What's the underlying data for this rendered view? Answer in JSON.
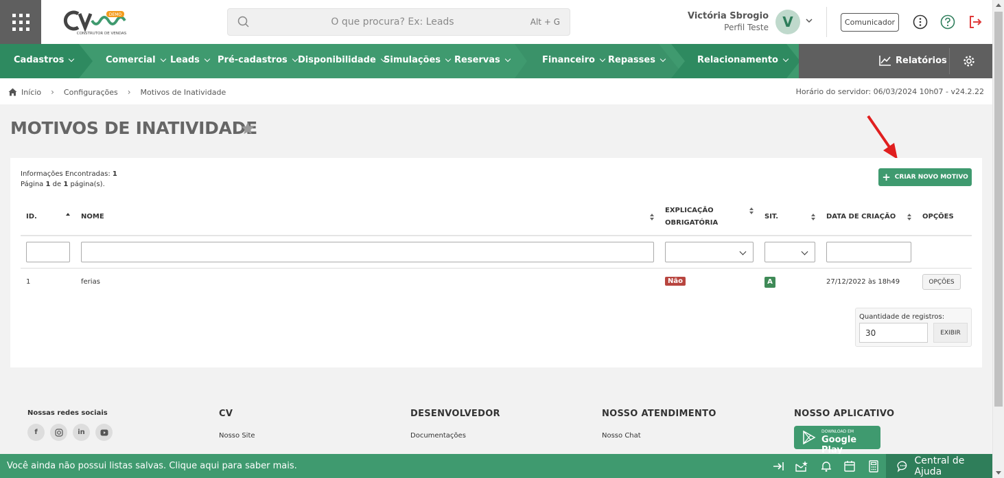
{
  "header": {
    "search_placeholder": "O que procura? Ex: Leads",
    "search_shortcut": "Alt + G",
    "user_name": "Victória Sbrogio",
    "user_profile": "Perfil Teste",
    "avatar_letter": "V",
    "communicator_label": "Comunicador",
    "logo_badge": "DEMO",
    "logo_subtitle": "CONSTRUTOR DE VENDAS"
  },
  "nav": {
    "items": [
      {
        "label": "Cadastros"
      },
      {
        "label": "Comercial"
      },
      {
        "label": "Leads"
      },
      {
        "label": "Pré-cadastros"
      },
      {
        "label": "Disponibilidade"
      },
      {
        "label": "Simulações"
      },
      {
        "label": "Reservas"
      },
      {
        "label": "Financeiro"
      },
      {
        "label": "Repasses"
      },
      {
        "label": "Relacionamento"
      }
    ],
    "reports_label": "Relatórios",
    "colors": {
      "green": "#3f9a6f",
      "green_dark": "#2e8a60",
      "gray": "#5f5f5f"
    }
  },
  "breadcrumb": {
    "items": [
      "Início",
      "Configurações",
      "Motivos de Inatividade"
    ],
    "server_time": "Horário do servidor: 06/03/2024 10h07 - v24.2.22"
  },
  "page": {
    "title": "MOTIVOS DE INATIVIDADE"
  },
  "card": {
    "info_found_label": "Informações Encontradas:",
    "info_found_count": "1",
    "page_word": "Página",
    "page_current": "1",
    "page_of": "de",
    "page_total": "1",
    "page_suffix": "página(s).",
    "create_button": "CRIAR NOVO MOTIVO",
    "columns": {
      "id": "ID.",
      "name": "NOME",
      "explanation_line1": "EXPLICAÇÃO",
      "explanation_line2": "OBRIGATÓRIA",
      "status": "SIT.",
      "created": "DATA DE CRIAÇÃO",
      "options": "OPÇÕES"
    },
    "rows": [
      {
        "id": "1",
        "name": "ferias",
        "explanation": "Não",
        "status": "A",
        "created": "27/12/2022 às 18h49",
        "options_button": "OPÇÕES"
      }
    ],
    "quantity_label": "Quantidade de registros:",
    "quantity_value": "30",
    "show_button": "EXIBIR"
  },
  "footer": {
    "social_title": "Nossas redes sociais",
    "social_icons": [
      "facebook-icon",
      "instagram-icon",
      "linkedin-icon",
      "youtube-icon"
    ],
    "cv_title": "CV",
    "cv_link": "Nosso Site",
    "dev_title": "DESENVOLVEDOR",
    "dev_link": "Documentações",
    "support_title": "NOSSO ATENDIMENTO",
    "support_link": "Nosso Chat",
    "app_title": "NOSSO APLICATIVO",
    "gplay_small": "DOWNLOAD EM",
    "gplay_big": "Google Play"
  },
  "bottombar": {
    "message": "Você ainda não possui listas salvas. Clique aqui para saber mais.",
    "help_label": "Central de Ajuda"
  }
}
